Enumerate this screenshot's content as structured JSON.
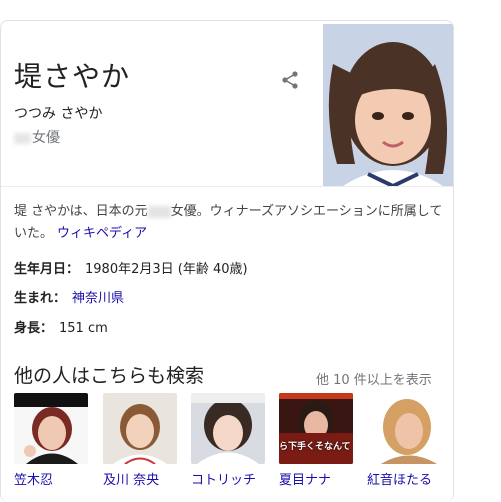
{
  "entity": {
    "title": "堤さやか",
    "reading": "つつみ さやか",
    "subtitle": "女優"
  },
  "description": {
    "part1": "堤 さやかは、日本の元",
    "part2": "女優。ウィナーズアソシエーションに所属していた。",
    "link": "ウィキペディア"
  },
  "facts": [
    {
      "key": "生年月日：",
      "value": "1980年2月3日 (年齢 40歳)"
    },
    {
      "key": "生まれ：",
      "value": "神奈川県"
    },
    {
      "key": "身長：",
      "value": "151 cm"
    }
  ],
  "people": {
    "title": "他の人はこちらも検索",
    "more": "他 10 件以上を表示",
    "items": [
      {
        "name": "笠木忍"
      },
      {
        "name": "及川 奈央"
      },
      {
        "name": "コトリッチ"
      },
      {
        "name": "夏目ナナ"
      },
      {
        "name": "紅音ほたる"
      }
    ],
    "thumb_caption": "ら下手くそなんて"
  },
  "colors": {
    "link": "#1a0dab",
    "muted": "#70757a",
    "border": "#dfe1e5"
  }
}
